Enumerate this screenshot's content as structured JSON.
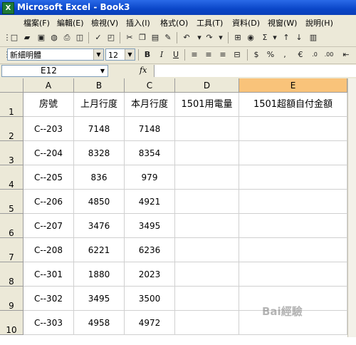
{
  "window": {
    "title": "Microsoft Excel - Book3",
    "app_icon": "X"
  },
  "menu": [
    "檔案(F)",
    "編輯(E)",
    "檢視(V)",
    "插入(I)",
    "格式(O)",
    "工具(T)",
    "資料(D)",
    "視窗(W)",
    "說明(H)"
  ],
  "format": {
    "font": "新細明體",
    "size": "12"
  },
  "formula_bar": {
    "cell_ref": "E12",
    "fx": "fx",
    "content": ""
  },
  "columns": [
    "A",
    "B",
    "C",
    "D",
    "E"
  ],
  "rows": [
    "1",
    "2",
    "3",
    "4",
    "5",
    "6",
    "7",
    "8",
    "9",
    "10"
  ],
  "header_row": [
    "房號",
    "上月行度",
    "本月行度",
    "1501用電量",
    "1501超額自付金額"
  ],
  "data_rows": [
    [
      "C--203",
      "7148",
      "7148",
      "",
      ""
    ],
    [
      "C--204",
      "8328",
      "8354",
      "",
      ""
    ],
    [
      "C--205",
      "836",
      "979",
      "",
      ""
    ],
    [
      "C--206",
      "4850",
      "4921",
      "",
      ""
    ],
    [
      "C--207",
      "3476",
      "3495",
      "",
      ""
    ],
    [
      "C--208",
      "6221",
      "6236",
      "",
      ""
    ],
    [
      "C--301",
      "1880",
      "2023",
      "",
      ""
    ],
    [
      "C--302",
      "3495",
      "3500",
      "",
      ""
    ],
    [
      "C--303",
      "4958",
      "4972",
      "",
      ""
    ]
  ],
  "watermark": "Bai經驗",
  "colors": {
    "selected_header": "#f9c37a",
    "titlebar": "#0a46c8",
    "chrome": "#ece9d8"
  }
}
